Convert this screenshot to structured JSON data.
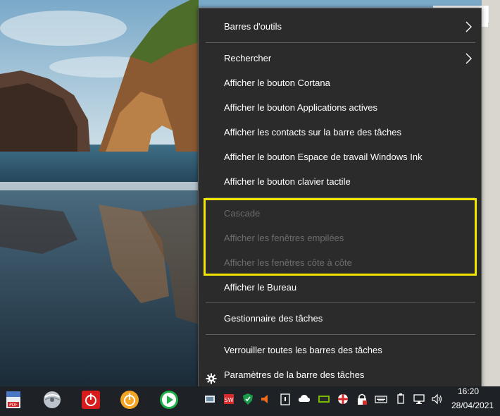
{
  "menu": {
    "items": [
      {
        "label": "Barres d'outils",
        "submenu": true
      },
      {
        "label": "Rechercher",
        "submenu": true
      },
      {
        "label": "Afficher le bouton Cortana"
      },
      {
        "label": "Afficher le bouton Applications actives"
      },
      {
        "label": "Afficher les contacts sur la barre des tâches"
      },
      {
        "label": "Afficher le bouton Espace de travail Windows Ink"
      },
      {
        "label": "Afficher le bouton clavier tactile"
      },
      {
        "label": "Cascade",
        "disabled": true
      },
      {
        "label": "Afficher les fenêtres empilées",
        "disabled": true
      },
      {
        "label": "Afficher les fenêtres côte à côte",
        "disabled": true
      },
      {
        "label": "Afficher le Bureau"
      },
      {
        "label": "Gestionnaire des tâches"
      },
      {
        "label": "Verrouiller toutes les barres des tâches"
      },
      {
        "label": "Paramètres de la barre des tâches",
        "icon": "gear-icon"
      }
    ],
    "highlight_color": "#f2e600"
  },
  "taskbar": {
    "apps": [
      {
        "icon": "pdf-icon"
      },
      {
        "icon": "pro-disc-icon"
      },
      {
        "icon": "power-red-icon"
      },
      {
        "icon": "power-orange-icon"
      },
      {
        "icon": "play-green-icon"
      }
    ],
    "tray": [
      "network-share-icon",
      "swiss-icon",
      "shield-icon",
      "volume-orange-icon",
      "clipboard-icon",
      "cloud-icon",
      "gpu-icon",
      "antivirus-icon",
      "lock-icon",
      "keyboard-icon",
      "usb-icon",
      "network-icon",
      "speaker-icon"
    ],
    "clock_time": "16:20",
    "clock_date": "28/04/2021"
  }
}
